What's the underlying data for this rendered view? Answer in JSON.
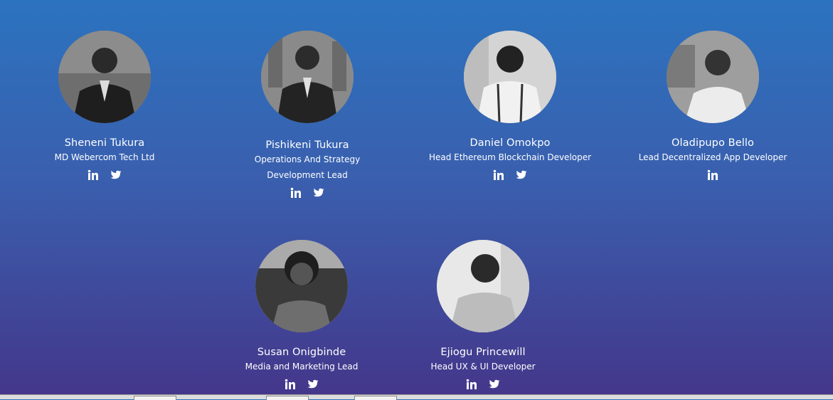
{
  "team": [
    {
      "name": "Sheneni Tukura",
      "role": "MD Webercom Tech Ltd",
      "socials": [
        "linkedin-icon",
        "twitter-icon"
      ]
    },
    {
      "name": "Pishikeni Tukura",
      "role": "Operations And Strategy Development Lead",
      "socials": [
        "linkedin-icon",
        "twitter-icon"
      ]
    },
    {
      "name": "Daniel Omokpo",
      "role": "Head Ethereum Blockchain Developer",
      "socials": [
        "linkedin-icon",
        "twitter-icon"
      ]
    },
    {
      "name": "Oladipupo Bello",
      "role": "Lead Decentralized App Developer",
      "socials": [
        "linkedin-icon"
      ]
    },
    {
      "name": "Susan Onigbinde",
      "role": "Media and Marketing Lead",
      "socials": [
        "linkedin-icon",
        "twitter-icon"
      ]
    },
    {
      "name": "Ejiogu Princewill",
      "role": "Head UX & UI Developer",
      "socials": [
        "linkedin-icon",
        "twitter-icon"
      ]
    }
  ],
  "colors": {
    "gradient_top": "#2b73bf",
    "gradient_bottom": "#44368a",
    "text": "#ffffff"
  }
}
